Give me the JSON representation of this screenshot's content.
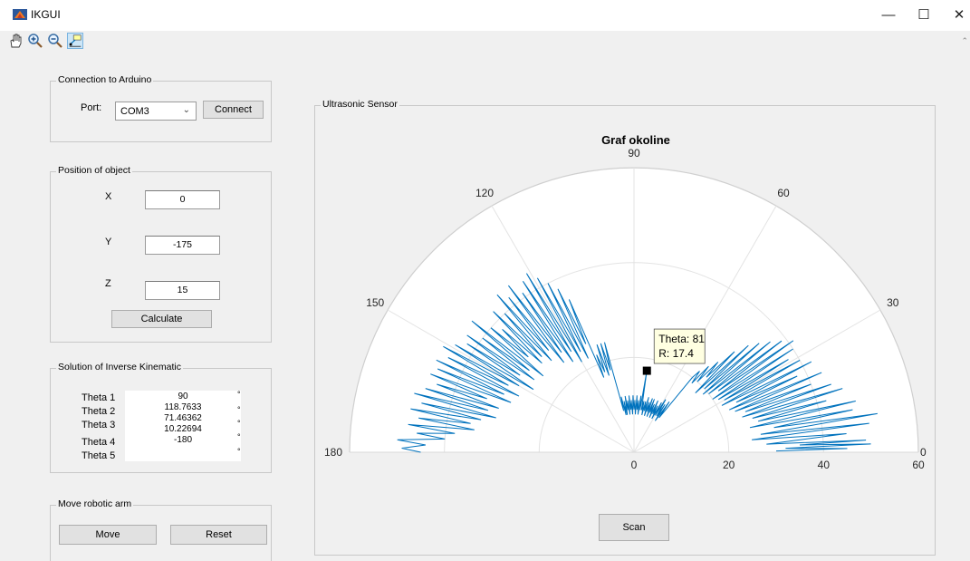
{
  "window": {
    "title": "IKGUI",
    "minimize_glyph": "—",
    "maximize_glyph": "☐",
    "close_glyph": "✕"
  },
  "toolbar": {
    "icons": [
      "pan-hand-icon",
      "zoom-in-icon",
      "zoom-out-icon",
      "data-cursor-icon"
    ],
    "overflow": "⌃"
  },
  "connection": {
    "title": "Connection to Arduino",
    "port_label": "Port:",
    "port_value": "COM3",
    "connect_label": "Connect"
  },
  "position": {
    "title": "Position of object",
    "x_label": "X",
    "x_value": "0",
    "y_label": "Y",
    "y_value": "-175",
    "z_label": "Z",
    "z_value": "15",
    "calculate_label": "Calculate"
  },
  "solution": {
    "title": "Solution of Inverse Kinematic",
    "theta_labels": [
      "Theta 1",
      "Theta 2",
      "Theta 3",
      "Theta 4",
      "Theta 5"
    ],
    "theta_values": [
      "90",
      "118.7633",
      "71.46362",
      "10.22694",
      "-180"
    ],
    "degree_mark": "°"
  },
  "move": {
    "title": "Move robotic arm",
    "move_label": "Move",
    "reset_label": "Reset"
  },
  "sensor": {
    "title": "Ultrasonic Sensor",
    "scan_label": "Scan"
  },
  "colors": {
    "series": "#0072bd",
    "grid": "#e3e3e3",
    "datatip_bg": "#ffffe1"
  },
  "chart_data": {
    "type": "polar-line",
    "title": "Graf okoline",
    "theta_range": [
      0,
      180
    ],
    "theta_ticks": [
      "0",
      "30",
      "60",
      "90",
      "120",
      "150",
      "180"
    ],
    "r_range": [
      0,
      60
    ],
    "r_ticks": [
      "0",
      "20",
      "40",
      "60"
    ],
    "grid": true,
    "datatip": {
      "theta": 81,
      "r": 17.4,
      "text_theta": "Theta: 81",
      "text_r": "R: 17.4"
    },
    "series": [
      {
        "points": [
          [
            0.5,
            30
          ],
          [
            1,
            45
          ],
          [
            1.5,
            32
          ],
          [
            2,
            50
          ],
          [
            2.5,
            35
          ],
          [
            3,
            49
          ],
          [
            3.5,
            28
          ],
          [
            5,
            45
          ],
          [
            6,
            25
          ],
          [
            7,
            50
          ],
          [
            8,
            27
          ],
          [
            9,
            52
          ],
          [
            10,
            30
          ],
          [
            11,
            47
          ],
          [
            12,
            25
          ],
          [
            13,
            48
          ],
          [
            14,
            27
          ],
          [
            15,
            42
          ],
          [
            16,
            26
          ],
          [
            17,
            46
          ],
          [
            18,
            24
          ],
          [
            19,
            44
          ],
          [
            20,
            25
          ],
          [
            21,
            40
          ],
          [
            22,
            23
          ],
          [
            23,
            43
          ],
          [
            24,
            22
          ],
          [
            25,
            38
          ],
          [
            26,
            24
          ],
          [
            27,
            42
          ],
          [
            28,
            21
          ],
          [
            29,
            40
          ],
          [
            30,
            22
          ],
          [
            31,
            38
          ],
          [
            32,
            21
          ],
          [
            33,
            40
          ],
          [
            34,
            20
          ],
          [
            35,
            41
          ],
          [
            36,
            22
          ],
          [
            37,
            39
          ],
          [
            38,
            20
          ],
          [
            39,
            37
          ],
          [
            40,
            19
          ],
          [
            41,
            35
          ],
          [
            42,
            20
          ],
          [
            43,
            33
          ],
          [
            44,
            18
          ],
          [
            45,
            30
          ],
          [
            46,
            22
          ],
          [
            47,
            26
          ],
          [
            48,
            20
          ],
          [
            49,
            24
          ],
          [
            50,
            19
          ],
          [
            51,
            22
          ],
          [
            52,
            20
          ],
          [
            53,
            12
          ],
          [
            54,
            9
          ],
          [
            55,
            13
          ],
          [
            56,
            8
          ],
          [
            57,
            12
          ],
          [
            58,
            9
          ],
          [
            59,
            13
          ],
          [
            60,
            9
          ],
          [
            61,
            12
          ],
          [
            62,
            8
          ],
          [
            63,
            11
          ],
          [
            64,
            9
          ],
          [
            65,
            12
          ],
          [
            66,
            8
          ],
          [
            67,
            11
          ],
          [
            68,
            9
          ],
          [
            69,
            12
          ],
          [
            70,
            8
          ],
          [
            71,
            12
          ],
          [
            72,
            9
          ],
          [
            73,
            11
          ],
          [
            74,
            8
          ],
          [
            75,
            12
          ],
          [
            76,
            9
          ],
          [
            77,
            11
          ],
          [
            78,
            8
          ],
          [
            79,
            11
          ],
          [
            80,
            9
          ],
          [
            81,
            17.4
          ],
          [
            82,
            9
          ],
          [
            83,
            12
          ],
          [
            84,
            8
          ],
          [
            85,
            11
          ],
          [
            86,
            9
          ],
          [
            87,
            12
          ],
          [
            88,
            8
          ],
          [
            89,
            11
          ],
          [
            90,
            9
          ],
          [
            91,
            12
          ],
          [
            92,
            8
          ],
          [
            93,
            11
          ],
          [
            94,
            9
          ],
          [
            95,
            12
          ],
          [
            96,
            8
          ],
          [
            97,
            11
          ],
          [
            98,
            9
          ],
          [
            99,
            12
          ],
          [
            100,
            8
          ],
          [
            101,
            11
          ],
          [
            102,
            8
          ],
          [
            103,
            12
          ],
          [
            104,
            9
          ],
          [
            105,
            24
          ],
          [
            106,
            18
          ],
          [
            107,
            24
          ],
          [
            108,
            17
          ],
          [
            109,
            24
          ],
          [
            110,
            18
          ],
          [
            111,
            22
          ],
          [
            112,
            17
          ],
          [
            113,
            35
          ],
          [
            114,
            25
          ],
          [
            115,
            38
          ],
          [
            116,
            22
          ],
          [
            117,
            40
          ],
          [
            118,
            24
          ],
          [
            119,
            42
          ],
          [
            120,
            22
          ],
          [
            121,
            44
          ],
          [
            122,
            25
          ],
          [
            123,
            43
          ],
          [
            124,
            23
          ],
          [
            125,
            41
          ],
          [
            126,
            26
          ],
          [
            127,
            44
          ],
          [
            128,
            24
          ],
          [
            129,
            42
          ],
          [
            130,
            28
          ],
          [
            131,
            44
          ],
          [
            132,
            26
          ],
          [
            133,
            40
          ],
          [
            134,
            28
          ],
          [
            135,
            42
          ],
          [
            136,
            27
          ],
          [
            137,
            38
          ],
          [
            138,
            30
          ],
          [
            139,
            40
          ],
          [
            140,
            25
          ],
          [
            141,
            44
          ],
          [
            142,
            28
          ],
          [
            143,
            40
          ],
          [
            144,
            26
          ],
          [
            145,
            43
          ],
          [
            146,
            29
          ],
          [
            147,
            42
          ],
          [
            148,
            25
          ],
          [
            149,
            44
          ],
          [
            150,
            28
          ],
          [
            151,
            46
          ],
          [
            152,
            30
          ],
          [
            153,
            44
          ],
          [
            154,
            27
          ],
          [
            155,
            46
          ],
          [
            156,
            30
          ],
          [
            157,
            45
          ],
          [
            158,
            28
          ],
          [
            159,
            46
          ],
          [
            160,
            33
          ],
          [
            161,
            44
          ],
          [
            162,
            30
          ],
          [
            163,
            46
          ],
          [
            164,
            32
          ],
          [
            165,
            48
          ],
          [
            166,
            30
          ],
          [
            167,
            46
          ],
          [
            168,
            33
          ],
          [
            169,
            48
          ],
          [
            170,
            35
          ],
          [
            171,
            46
          ],
          [
            172,
            34
          ],
          [
            173,
            48
          ],
          [
            174,
            38
          ],
          [
            175,
            46
          ],
          [
            176,
            40
          ],
          [
            177,
            50
          ],
          [
            178,
            44
          ],
          [
            179,
            49
          ],
          [
            180,
            45
          ]
        ]
      }
    ]
  }
}
